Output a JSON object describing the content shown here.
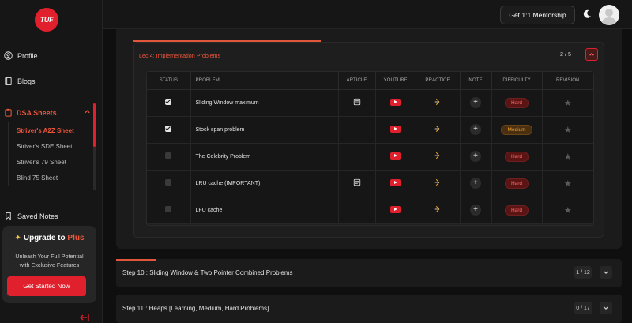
{
  "logo": {
    "text": "TUF"
  },
  "nav": {
    "profile": "Profile",
    "blogs": "Blogs",
    "dsa_sheets": "DSA Sheets",
    "sheets": [
      {
        "label": "Striver's A2Z Sheet",
        "active": true
      },
      {
        "label": "Striver's SDE Sheet",
        "active": false
      },
      {
        "label": "Striver's 79 Sheet",
        "active": false
      },
      {
        "label": "Blind 75 Sheet",
        "active": false
      }
    ],
    "saved_notes": "Saved Notes"
  },
  "upgrade": {
    "title_prefix": "Upgrade to ",
    "title_plus": "Plus",
    "desc_line1": "Unleash Your Full Potential",
    "desc_line2": "with Exclusive Features",
    "cta": "Get Started Now"
  },
  "header": {
    "mentorship_button": "Get 1:1 Mentorship"
  },
  "lecture": {
    "title": "Lec 4: Implementation Problems",
    "count": "2 / 5",
    "columns": [
      "Status",
      "Problem",
      "Article",
      "Youtube",
      "Practice",
      "Note",
      "Difficulty",
      "Revision"
    ],
    "rows": [
      {
        "problem": "Sliding Window maximum",
        "done": true,
        "article": true,
        "difficulty": "Hard"
      },
      {
        "problem": "Stock span problem",
        "done": true,
        "article": false,
        "difficulty": "Medium"
      },
      {
        "problem": "The Celebrity Problem",
        "done": false,
        "article": false,
        "difficulty": "Hard"
      },
      {
        "problem": "LRU cache (IMPORTANT)",
        "done": false,
        "article": true,
        "difficulty": "Hard"
      },
      {
        "problem": "LFU cache",
        "done": false,
        "article": false,
        "difficulty": "Hard"
      }
    ]
  },
  "steps": [
    {
      "label": "Step 10 : Sliding Window & Two Pointer Combined Problems",
      "count": "1 / 12",
      "progress": 0.08
    },
    {
      "label": "Step 11 : Heaps [Learning, Medium, Hard Problems]",
      "count": "0 / 17",
      "progress": 0
    }
  ],
  "colors": {
    "accent": "#e0202c",
    "accent_orange": "#f0563a"
  }
}
